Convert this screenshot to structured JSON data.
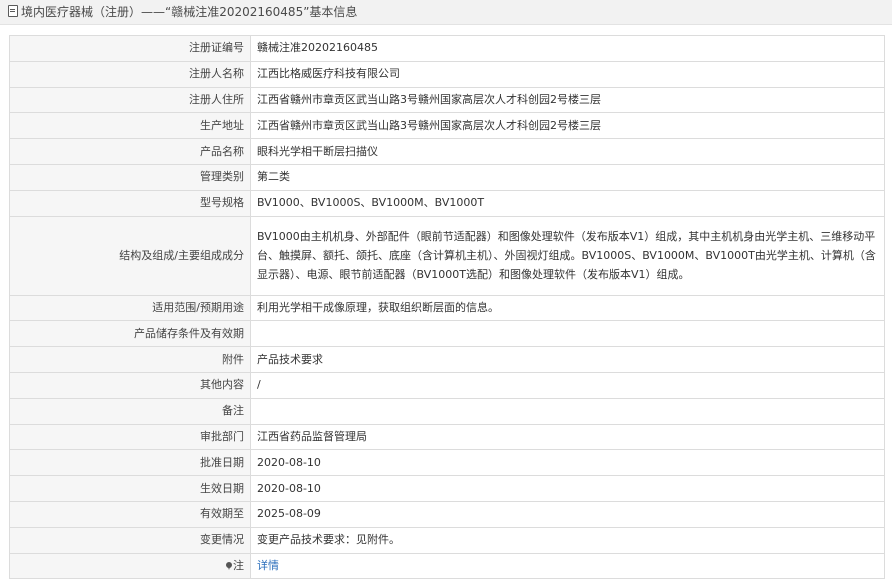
{
  "header": {
    "icon": "document-icon",
    "title": "境内医疗器械（注册）——“赣械注准20202160485”基本信息"
  },
  "rows": [
    {
      "label": "注册证编号",
      "value": "赣械注准20202160485"
    },
    {
      "label": "注册人名称",
      "value": "江西比格威医疗科技有限公司"
    },
    {
      "label": "注册人住所",
      "value": "江西省赣州市章贡区武当山路3号赣州国家高层次人才科创园2号楼三层"
    },
    {
      "label": "生产地址",
      "value": "江西省赣州市章贡区武当山路3号赣州国家高层次人才科创园2号楼三层"
    },
    {
      "label": "产品名称",
      "value": "眼科光学相干断层扫描仪"
    },
    {
      "label": "管理类别",
      "value": "第二类"
    },
    {
      "label": "型号规格",
      "value": "BV1000、BV1000S、BV1000M、BV1000T"
    },
    {
      "label": "结构及组成/主要组成成分",
      "value": "BV1000由主机机身、外部配件（眼前节适配器）和图像处理软件（发布版本V1）组成，其中主机机身由光学主机、三维移动平台、触摸屏、额托、颌托、底座（含计算机主机）、外固视灯组成。BV1000S、BV1000M、BV1000T由光学主机、计算机（含显示器）、电源、眼节前适配器（BV1000T选配）和图像处理软件（发布版本V1）组成。"
    },
    {
      "label": "适用范围/预期用途",
      "value": "利用光学相干成像原理，获取组织断层面的信息。"
    },
    {
      "label": "产品储存条件及有效期",
      "value": ""
    },
    {
      "label": "附件",
      "value": "产品技术要求"
    },
    {
      "label": "其他内容",
      "value": "/"
    },
    {
      "label": "备注",
      "value": ""
    },
    {
      "label": "审批部门",
      "value": "江西省药品监督管理局"
    },
    {
      "label": "批准日期",
      "value": "2020-08-10"
    },
    {
      "label": "生效日期",
      "value": "2020-08-10"
    },
    {
      "label": "有效期至",
      "value": "2025-08-09"
    },
    {
      "label": "变更情况",
      "value": "变更产品技术要求：见附件。"
    },
    {
      "label": "注",
      "value": "详情",
      "icon": "pin-icon"
    }
  ],
  "colors": {
    "link": "#2a6ebb",
    "label_bg": "#f6f6f6",
    "border": "#dcdcdc",
    "topbar_bg": "#f2f2f2"
  }
}
